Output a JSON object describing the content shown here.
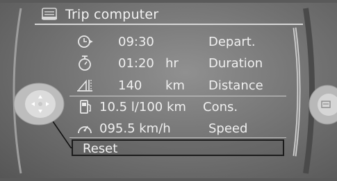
{
  "header": {
    "title": "Trip computer",
    "icon": "car-icon"
  },
  "rows": [
    {
      "icon": "clock-arrow-icon",
      "value": "09:30",
      "unit": "",
      "label": "Depart."
    },
    {
      "icon": "stopwatch-icon",
      "value": "01:20",
      "unit": "hr",
      "label": "Duration"
    },
    {
      "icon": "road-distance-icon",
      "value": "140",
      "unit": "km",
      "label": "Distance"
    },
    {
      "icon": "fuel-pump-icon",
      "value": "10.5 l/100 km",
      "unit": "",
      "label": "Cons."
    },
    {
      "icon": "speedometer-icon",
      "value": "095.5 km/h",
      "unit": "",
      "label": "Speed"
    }
  ],
  "reset": {
    "label": "Reset"
  },
  "controller": {
    "icon": "four-way-arrows-icon"
  },
  "right_knob": {
    "icon": "options-icon"
  },
  "colors": {
    "screen_bg": "#6f6f6f",
    "text": "#f0f0f0",
    "highlight_border": "#1b1b1b"
  }
}
